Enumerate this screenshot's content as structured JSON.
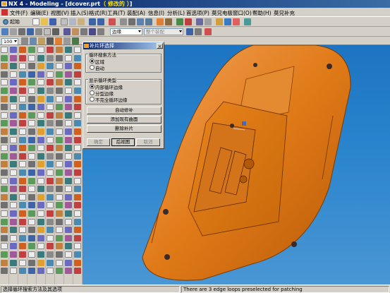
{
  "window": {
    "title_prefix": "NX 4 - Modeling - [dcover.prt",
    "title_highlight": "（ 修改的 ）",
    "title_suffix": "]"
  },
  "menu": {
    "items": [
      "文件(F)",
      "编辑(E)",
      "视图(V)",
      "插入(S)",
      "格式(R)",
      "工具(T)",
      "装配(A)",
      "信息(I)",
      "分析(L)",
      "首选项(P)",
      "莫兄电极",
      "窗口(O)",
      "帮助(H)",
      "莫兄补充"
    ]
  },
  "toolbar": {
    "start_label": "起始",
    "zoom_value": "100",
    "selection_filter_value": "边缘",
    "assembly_scope_value": "整个装配"
  },
  "dialog": {
    "title": "补片环选择",
    "close_label": "×",
    "group1_title": "循环搜索方法",
    "group1_options": [
      {
        "label": "区域",
        "selected": true
      },
      {
        "label": "自动",
        "selected": false
      }
    ],
    "group2_title": "显示循环类型",
    "group2_options": [
      {
        "label": "内部循环边缘",
        "selected": true
      },
      {
        "label": "分型边缘",
        "selected": false
      },
      {
        "label": "不完全循环边缘",
        "selected": false
      }
    ],
    "buttons": [
      "自动修补",
      "添加现有曲面",
      "删除补片"
    ],
    "ok_label": "确定",
    "back_label": "后视图",
    "cancel_label": "取消"
  },
  "status": {
    "left": "选择循环搜索方法及其选项",
    "right": "There are 3 edge loops preselected for patching"
  }
}
